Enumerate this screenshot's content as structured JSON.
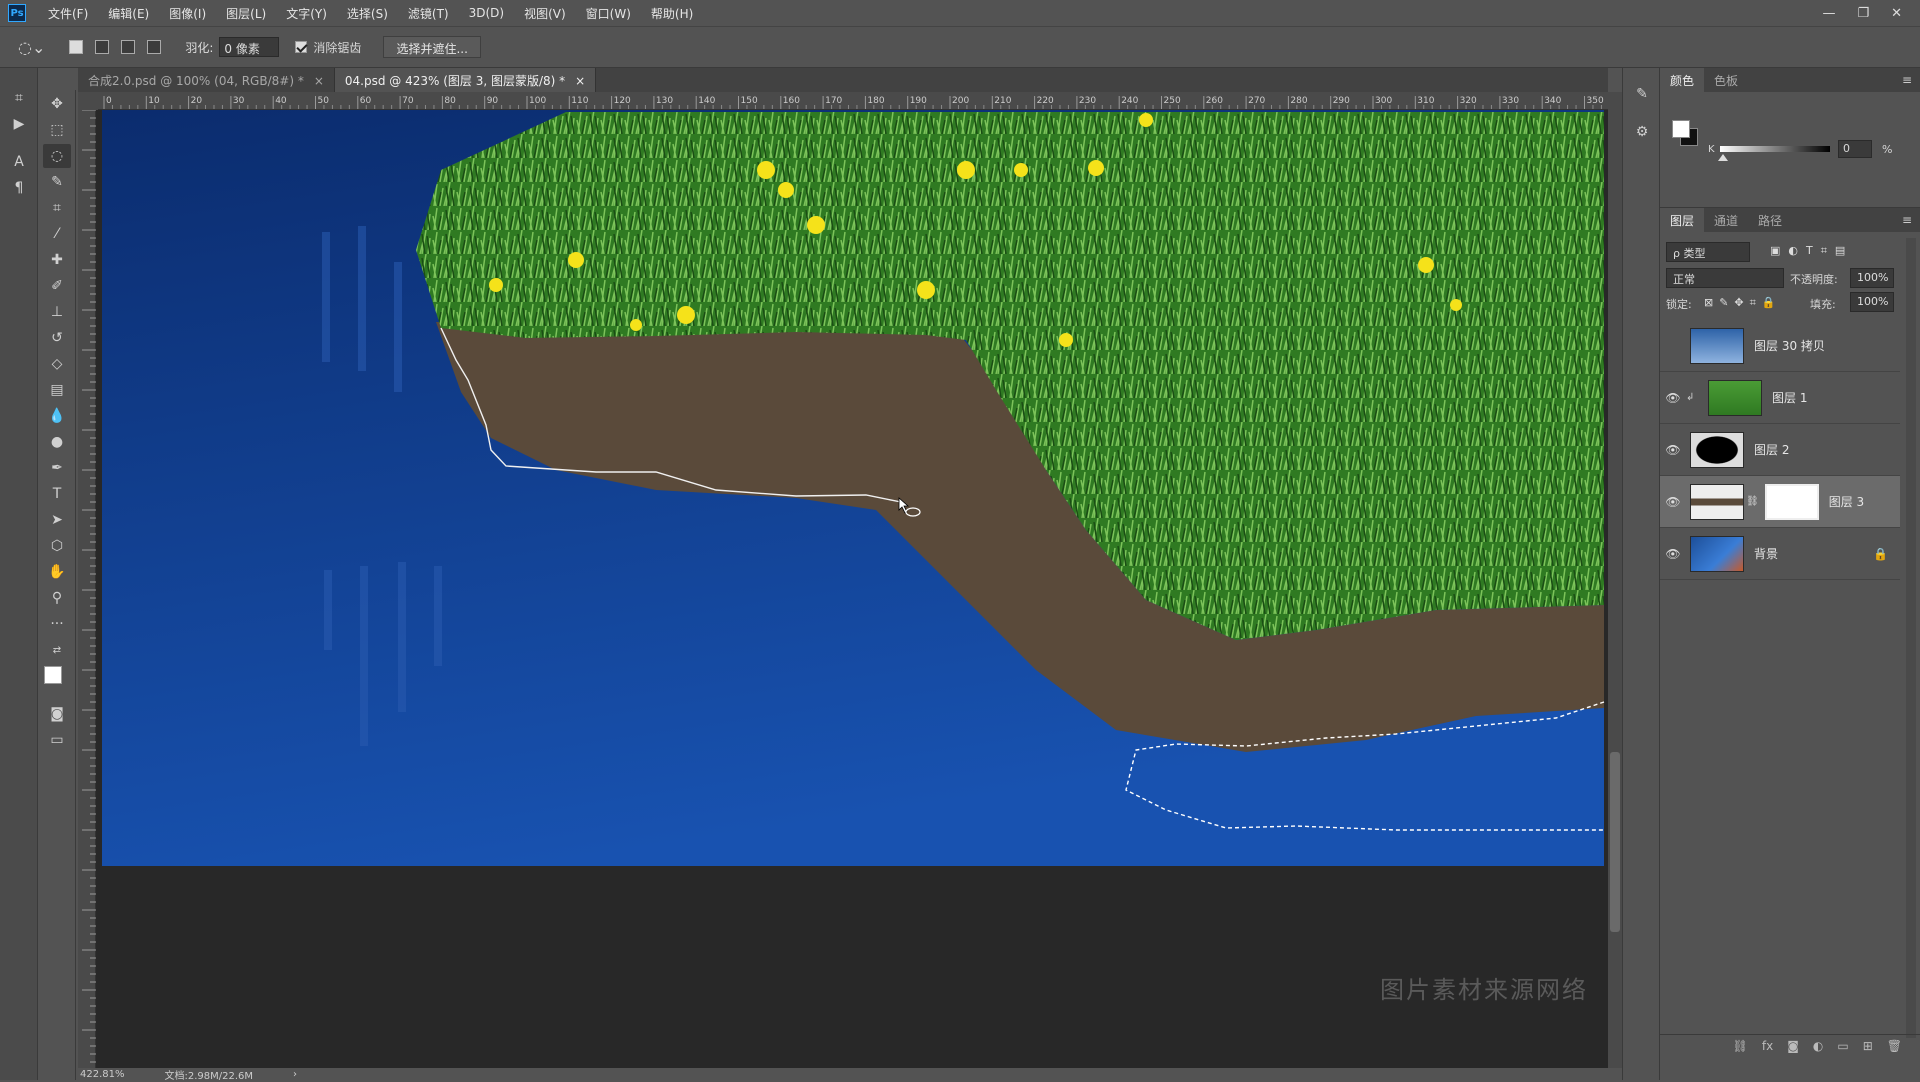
{
  "app": {
    "logo": "Ps"
  },
  "menu": [
    "文件(F)",
    "编辑(E)",
    "图像(I)",
    "图层(L)",
    "文字(Y)",
    "选择(S)",
    "滤镜(T)",
    "3D(D)",
    "视图(V)",
    "窗口(W)",
    "帮助(H)"
  ],
  "window_controls": {
    "minimize": "—",
    "restore": "❐",
    "close": "✕"
  },
  "options": {
    "feather_label": "羽化:",
    "feather_value": "0 像素",
    "antialias_label": "消除锯齿",
    "select_mask_button": "选择并遮住..."
  },
  "tabs": [
    {
      "label": "合成2.0.psd @ 100% (04, RGB/8#) *",
      "close": "×"
    },
    {
      "label": "04.psd @ 423% (图层 3, 图层蒙版/8) *",
      "close": "×"
    }
  ],
  "ruler_ticks": [
    "0",
    "10",
    "20",
    "30",
    "40",
    "50",
    "60",
    "70",
    "80",
    "90",
    "100",
    "110",
    "120",
    "130",
    "140",
    "150",
    "160",
    "170",
    "180",
    "190",
    "200",
    "210",
    "220",
    "230",
    "240",
    "250",
    "260",
    "270",
    "280",
    "290",
    "300",
    "310",
    "320",
    "330",
    "340",
    "350"
  ],
  "canvas": {
    "watermark": "图片素材来源网络",
    "colors": {
      "sky_top": "#0b2c6e",
      "sky_bottom": "#1852b0",
      "dirt": "#5a4a3a",
      "grass": "#3e8a2c",
      "flower": "#f5e21a"
    }
  },
  "status": {
    "zoom": "422.81%",
    "doc": "文档:2.98M/22.6M",
    "arrow": "›"
  },
  "color_panel": {
    "tabs": [
      "颜色",
      "色板"
    ],
    "k_label": "K",
    "k_value": "0",
    "pct": "%"
  },
  "layers_panel": {
    "tabs": [
      "图层",
      "通道",
      "路径"
    ],
    "filter": "ρ 类型",
    "blend_mode": "正常",
    "opacity_label": "不透明度:",
    "opacity_value": "100%",
    "lock_label": "锁定:",
    "fill_label": "填充:",
    "fill_value": "100%",
    "layers": [
      {
        "name": "图层 30 拷贝",
        "visible": false
      },
      {
        "name": "图层 1",
        "visible": true
      },
      {
        "name": "图层 2",
        "visible": true
      },
      {
        "name": "图层 3",
        "visible": true,
        "selected": true
      },
      {
        "name": "背景",
        "visible": true,
        "locked": true
      }
    ]
  }
}
